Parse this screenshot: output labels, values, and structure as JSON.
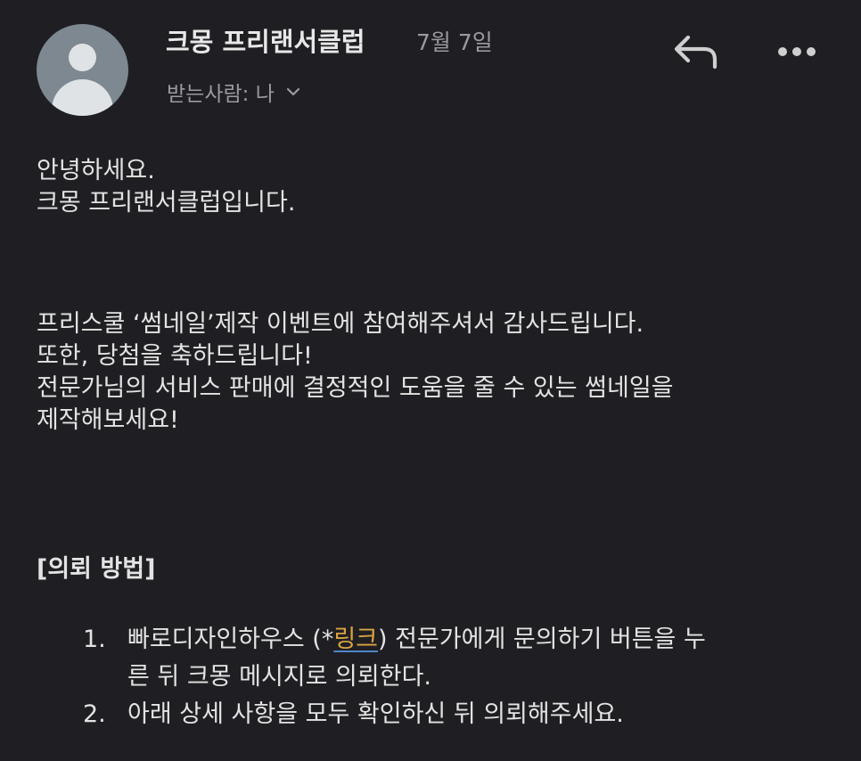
{
  "header": {
    "sender": "크몽 프리랜서클럽",
    "date": "7월 7일",
    "recipient_label": "받는사람: 나",
    "avatar_icon": "default-person-avatar",
    "reply_icon": "reply-arrow-icon",
    "more_icon": "more-dots-icon"
  },
  "body": {
    "greeting": [
      "안녕하세요.",
      "크몽 프리랜서클럽입니다."
    ],
    "paragraph": [
      "프리스쿨 ‘썸네일’제작 이벤트에 참여해주셔서 감사드립니다.",
      "또한, 당첨을 축하드립니다!",
      "전문가님의 서비스 판매에 결정적인 도움을 줄 수 있는 썸네일을",
      "제작해보세요!"
    ],
    "section_title": "[의뢰 방법]",
    "steps": [
      {
        "num": "1.",
        "before_link": "빠로디자인하우스 (*",
        "link": "링크",
        "after_link": ") 전문가에게 문의하기 버튼을 누",
        "continuation": "른 뒤 크몽 메시지로 의뢰한다."
      },
      {
        "num": "2.",
        "text": "아래 상세 사항을 모두 확인하신 뒤 의뢰해주세요."
      }
    ]
  },
  "colors": {
    "background": "#1f1f23",
    "text": "#e3e3e3",
    "muted": "#9a9a9f",
    "link": "#d9a441",
    "link_underline": "#4f86c7"
  }
}
